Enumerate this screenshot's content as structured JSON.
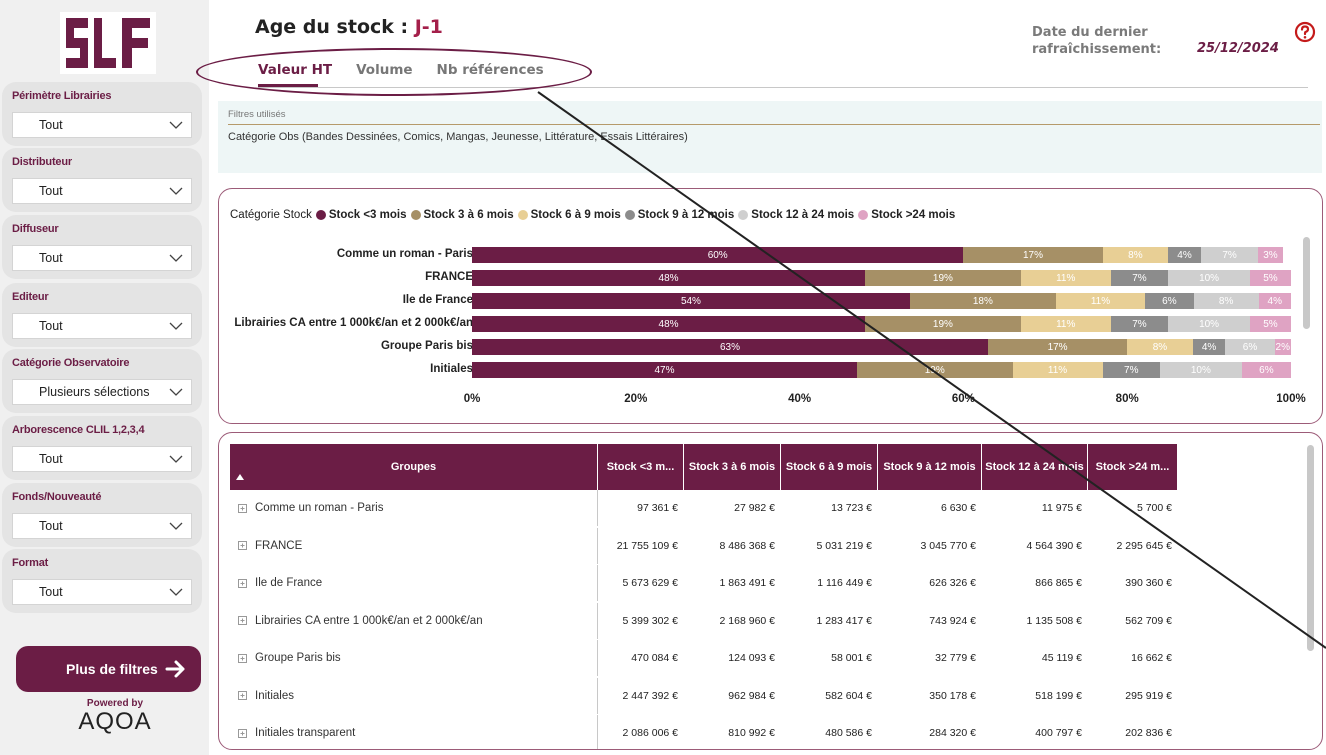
{
  "header": {
    "title_prefix": "Age du stock : ",
    "title_accent": "J-1",
    "refresh_label_line1": "Date du dernier",
    "refresh_label_line2": "rafraîchissement:",
    "refresh_date": "25/12/2024",
    "help_icon": "question-circle-icon"
  },
  "tabs": [
    {
      "label": "Valeur HT",
      "active": true
    },
    {
      "label": "Volume",
      "active": false
    },
    {
      "label": "Nb références",
      "active": false
    }
  ],
  "sidebar": {
    "logo_text": "SLF",
    "filters": [
      {
        "label": "Périmètre Librairies",
        "value": "Tout"
      },
      {
        "label": "Distributeur",
        "value": "Tout"
      },
      {
        "label": "Diffuseur",
        "value": "Tout"
      },
      {
        "label": "Editeur",
        "value": "Tout"
      },
      {
        "label": "Catégorie Observatoire",
        "value": "Plusieurs sélections"
      },
      {
        "label": "Arborescence CLIL 1,2,3,4",
        "value": "Tout"
      },
      {
        "label": "Fonds/Nouveauté",
        "value": "Tout"
      },
      {
        "label": "Format",
        "value": "Tout"
      }
    ],
    "more_filters_label": "Plus de filtres",
    "powered_by": "Powered by",
    "powered_brand": "AQOA"
  },
  "filters_used": {
    "label": "Filtres utilisés",
    "text": "Catégorie Obs (Bandes Dessinées, Comics, Mangas, Jeunesse, Littérature, Essais Littéraires)"
  },
  "chart_data": {
    "type": "bar",
    "orientation": "horizontal",
    "stacked": "percent",
    "legend_title": "Catégorie Stock",
    "legend_position": "top-left",
    "xlim": [
      0,
      100
    ],
    "x_ticks": [
      "0%",
      "20%",
      "40%",
      "60%",
      "80%",
      "100%"
    ],
    "categories": [
      "Comme un roman - Paris",
      "FRANCE",
      "Ile de France",
      "Librairies CA entre 1 000k€/an et 2 000k€/an",
      "Groupe Paris bis",
      "Initiales"
    ],
    "series": [
      {
        "name": "Stock <3 mois",
        "color": "#6b1d45",
        "values": [
          60,
          48,
          54,
          48,
          63,
          47
        ]
      },
      {
        "name": "Stock 3 à 6 mois",
        "color": "#a69066",
        "values": [
          17,
          19,
          18,
          19,
          17,
          19
        ]
      },
      {
        "name": "Stock 6 à 9 mois",
        "color": "#e8cf95",
        "values": [
          8,
          11,
          11,
          11,
          8,
          11
        ]
      },
      {
        "name": "Stock 9 à 12 mois",
        "color": "#8c8c8c",
        "values": [
          4,
          7,
          6,
          7,
          4,
          7
        ]
      },
      {
        "name": "Stock 12 à 24 mois",
        "color": "#cfcfcf",
        "values": [
          7,
          10,
          8,
          10,
          6,
          10
        ]
      },
      {
        "name": "Stock >24 mois",
        "color": "#dfa3c3",
        "values": [
          3,
          5,
          4,
          5,
          2,
          6
        ]
      }
    ]
  },
  "table": {
    "columns": [
      "Groupes",
      "Stock <3 m...",
      "Stock 3 à 6 mois",
      "Stock 6 à 9 mois",
      "Stock 9 à 12 mois",
      "Stock 12 à 24 mois",
      "Stock >24 m..."
    ],
    "rows": [
      {
        "name": "Comme un roman - Paris",
        "values": [
          "97 361 €",
          "27 982 €",
          "13 723 €",
          "6 630 €",
          "11 975 €",
          "5 700 €"
        ]
      },
      {
        "name": "FRANCE",
        "values": [
          "21 755 109 €",
          "8 486 368 €",
          "5 031 219 €",
          "3 045 770 €",
          "4 564 390 €",
          "2 295 645 €"
        ]
      },
      {
        "name": "Ile de France",
        "values": [
          "5 673 629 €",
          "1 863 491 €",
          "1 116 449 €",
          "626 326 €",
          "866 865 €",
          "390 360 €"
        ]
      },
      {
        "name": "Librairies CA entre 1 000k€/an et 2 000k€/an",
        "values": [
          "5 399 302 €",
          "2 168 960 €",
          "1 283 417 €",
          "743 924 €",
          "1 135 508 €",
          "562 709 €"
        ]
      },
      {
        "name": "Groupe Paris bis",
        "values": [
          "470 084 €",
          "124 093 €",
          "58 001 €",
          "32 779 €",
          "45 119 €",
          "16 662 €"
        ]
      },
      {
        "name": "Initiales",
        "values": [
          "2 447 392 €",
          "962 984 €",
          "582 604 €",
          "350 178 €",
          "518 199 €",
          "295 919 €"
        ]
      },
      {
        "name": "Initiales transparent",
        "values": [
          "2 086 006 €",
          "810 992 €",
          "480 586 €",
          "284 320 €",
          "400 797 €",
          "202 836 €"
        ]
      }
    ]
  }
}
